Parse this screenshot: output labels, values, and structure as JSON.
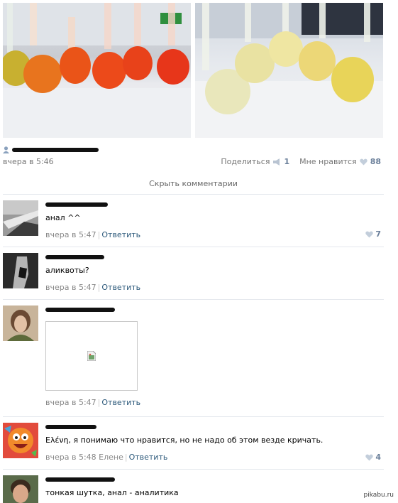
{
  "post": {
    "date": "вчера в 5:46",
    "share_label": "Поделиться",
    "share_count": "1",
    "like_label": "Мне нравится",
    "like_count": "88"
  },
  "comments_toggle": "Скрыть комментарии",
  "comments": [
    {
      "text": "анал ^^",
      "date": "вчера в 5:47",
      "reply": "Ответить",
      "likes": "7"
    },
    {
      "text": "аликвоты?",
      "date": "вчера в 5:47",
      "reply": "Ответить",
      "likes": ""
    },
    {
      "text": "",
      "date": "вчера в 5:47",
      "reply": "Ответить",
      "likes": ""
    },
    {
      "text": "Ελένη, я понимаю что нравится, но не надо об этом везде кричать.",
      "date": "вчера в 5:48 Елене",
      "reply": "Ответить",
      "likes": "4"
    },
    {
      "text": "тонкая шутка, анал - аналитика",
      "date": "",
      "reply": "",
      "likes": ""
    }
  ],
  "watermark": "pikabu.ru",
  "colors": {
    "link": "#2b587a",
    "muted": "#777777",
    "like": "#6a7f9a",
    "separator": "#e4e8ed"
  },
  "icons": [
    "user-icon",
    "megaphone-icon",
    "heart-icon",
    "broken-image-icon"
  ]
}
